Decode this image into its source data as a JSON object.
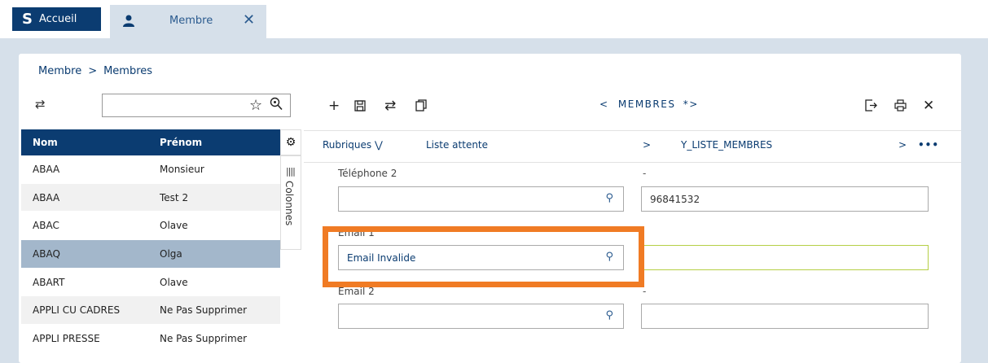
{
  "tabs": {
    "home_label": "Accueil",
    "home_logo": "S",
    "active_label": "Membre",
    "close_icon": "close-icon"
  },
  "breadcrumb": {
    "parent": "Membre",
    "current": "Membres"
  },
  "left": {
    "search_value": "",
    "grid": {
      "headers": [
        "Nom",
        "Prénom"
      ],
      "rows": [
        [
          "ABAA",
          "Monsieur"
        ],
        [
          "ABAA",
          "Test 2"
        ],
        [
          "ABAC",
          "Olave"
        ],
        [
          "ABAQ",
          "Olga"
        ],
        [
          "ABART",
          "Olave"
        ],
        [
          "APPLI CU CADRES",
          "Ne Pas Supprimer"
        ],
        [
          "APPLI PRESSE",
          "Ne Pas Supprimer"
        ]
      ],
      "selected_row": 3
    },
    "colonnes_label": "Colonnes"
  },
  "toolbar": {
    "title": "MEMBRES",
    "title_modified": "*"
  },
  "nav": {
    "rubriques": "Rubriques",
    "liste_attente": "Liste attente",
    "list_name": "Y_LISTE_MEMBRES"
  },
  "form": {
    "telephone2_label": "Téléphone 2",
    "telephone2_value": "",
    "telephone2_right_value": "96841532",
    "email1_label": "Email 1",
    "email1_value": "Email Invalide",
    "email2_label": "Email 2",
    "email2_value": "",
    "dash": "-"
  },
  "colors": {
    "brand": "#0b3c71",
    "highlight": "#f07b24",
    "selected_row": "#a3b7cb",
    "email_right_border": "#b5cf45"
  }
}
